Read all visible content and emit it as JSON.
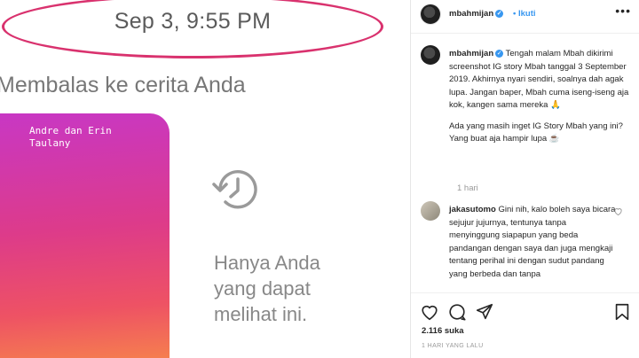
{
  "dm": {
    "timestamp": "Sep 3, 9:55 PM",
    "reply_label": "Membalas ke cerita Anda",
    "story_text": "Andre dan Erin Taulany",
    "hidden_message": [
      "Hanya Anda",
      "yang dapat",
      "melihat ini."
    ]
  },
  "post": {
    "username": "mbahmijan",
    "follow_label": "Ikuti",
    "caption": {
      "username": "mbahmijan",
      "paragraph1": "Tengah malam Mbah dikirimi screenshot IG story Mbah tanggal 3 September 2019. Akhirnya nyari sendiri, soalnya dah agak lupa. Jangan baper, Mbah cuma iseng-iseng aja kok, kangen sama mereka 🙏",
      "paragraph2": "Ada yang masih inget IG Story Mbah yang ini? Yang buat aja hampir lupa ☕"
    },
    "time_ago": "1 hari",
    "comment": {
      "username": "jakasutomo",
      "text": "Gini nih, kalo boleh saya bicara sejujur jujurnya, tentunya tanpa menyinggung siapapun yang beda pandangan dengan saya dan juga mengkaji tentang perihal ini dengan sudut pandang yang berbeda dan tanpa"
    },
    "likes": "2.116 suka",
    "posted": "1 HARI YANG LALU"
  },
  "colors": {
    "accent_blue": "#3897f0",
    "highlight_ring": "#d9326e"
  },
  "icons": [
    "history-icon",
    "verified-icon",
    "more-icon",
    "heart-icon",
    "comment-icon",
    "share-icon",
    "bookmark-icon"
  ]
}
